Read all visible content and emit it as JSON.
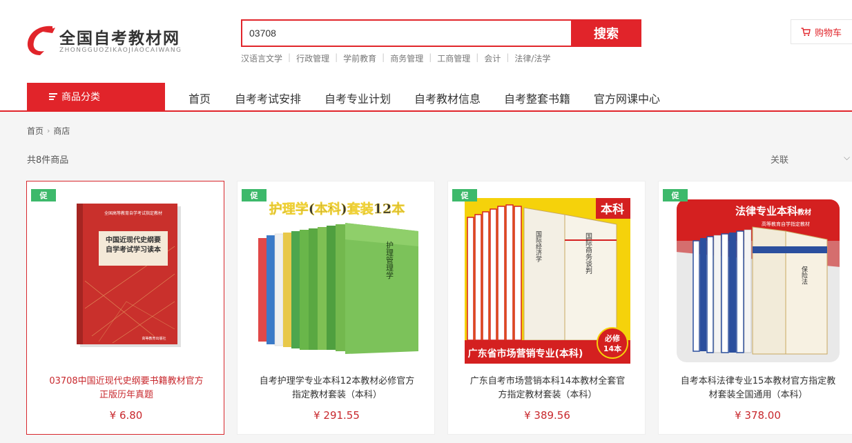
{
  "header": {
    "logo_title": "全国自考教材网",
    "logo_sub": "ZHONGGUOZIKAOJIAOCAIWANG",
    "search_value": "03708",
    "search_button": "搜索",
    "hot_words": [
      "汉语言文学",
      "行政管理",
      "学前教育",
      "商务管理",
      "工商管理",
      "会计",
      "法律/法学"
    ],
    "cart_label": "购物车"
  },
  "nav": {
    "category_button": "商品分类",
    "items": [
      "首页",
      "自考考试安排",
      "自考专业计划",
      "自考教材信息",
      "自考整套书籍",
      "官方网课中心"
    ]
  },
  "breadcrumb": [
    "首页",
    "商店"
  ],
  "toolbar": {
    "count_text": "共8件商品",
    "sort_label": "关联",
    "sort_caret": "⌵"
  },
  "colors": {
    "brand_red": "#e1242a",
    "promo_green": "#3db96b"
  },
  "products": [
    {
      "promo": "促",
      "title": "03708中国近现代史纲要书籍教材官方正版历年真题",
      "price": "¥ 6.80",
      "cover": {
        "series": "全国高等教育自学考试指定教材",
        "book_title": "中国近现代史纲要",
        "book_sub": "自学考试学习读本",
        "publisher": "高等教育出版社"
      }
    },
    {
      "promo": "促",
      "title": "自考护理学专业本科12本教材必修官方指定教材套装（本科）",
      "price": "¥ 291.55",
      "cover": {
        "banner": "护理学(本科)套装12本",
        "front_title": "护理管理学"
      }
    },
    {
      "promo": "促",
      "title": "广东自考市场营销本科14本教材全套官方指定教材套装（本科）",
      "price": "¥ 389.56",
      "cover": {
        "tag": "本科",
        "front_title": "国际商务谈判",
        "spine_title": "国际经济学",
        "footer": "广东省市场营销专业(本科)",
        "badge_line1": "必修",
        "badge_line2": "14本"
      }
    },
    {
      "promo": "促",
      "title": "自考本科法律专业15本教材官方指定教材套装全国通用（本科）",
      "price": "¥ 378.00",
      "cover": {
        "headline": "法律专业本科",
        "headline_small": "教材",
        "subline": "高等教育自学指定教材",
        "front_title": "保险法"
      }
    }
  ]
}
